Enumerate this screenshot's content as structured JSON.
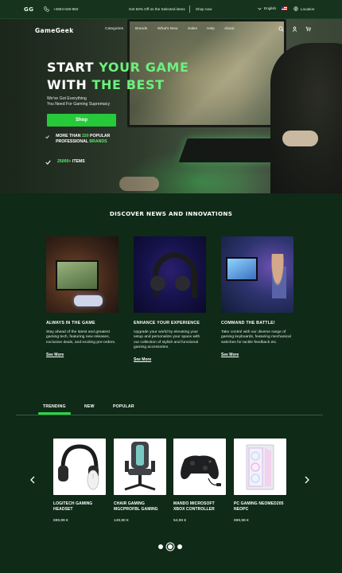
{
  "topbar": {
    "logo": "GG",
    "phone": "+4904-049-950",
    "promo": "Get 50% Off on the Selected items",
    "shop_now": "Shop now",
    "language": "English",
    "location": "Location"
  },
  "nav": {
    "brand": "GameGeek",
    "items": [
      "Categories",
      "Brands",
      "What's New",
      "Sales",
      "Help",
      "About"
    ]
  },
  "hero": {
    "title_line1_white": "START ",
    "title_line1_green": "YOUR GAME",
    "title_line2_white": "WITH ",
    "title_line2_green": "THE BEST",
    "subtitle_line1": "We've Got Everything",
    "subtitle_line2": "You Need For Gaming Supremacy",
    "cta": "Shop",
    "feature1_pre": "MORE THAN ",
    "feature1_num": "150",
    "feature1_mid": " POPULAR PROFESSIONAL ",
    "feature1_green": "BRANDS",
    "feature2_num": "25000+",
    "feature2_post": " ITEMS"
  },
  "discover": {
    "title": "DISCOVER NEWS AND INNOVATIONS",
    "cards": [
      {
        "title": "ALWAYS IN THE GAME",
        "text": "Stay ahead of the latest and greatest gaming tech, featuring new releases, exclusive deals, and exciting pre-orders.",
        "link": "See More"
      },
      {
        "title": "ENHANCE YOUR EXPERIENCE",
        "text": "Upgrade your world by elevating your setup and personalize your space with our collection of stylish and functional gaming accessories.",
        "link": "See More"
      },
      {
        "title": "COMMAND THE BATTLE!",
        "text": "Take control with our diverse range of gaming keyboards, featuring mechanical switches for tactile feedback etc.",
        "link": "See More"
      }
    ]
  },
  "tabs": [
    "TRENDING",
    "NEW",
    "POPULAR"
  ],
  "products": [
    {
      "name": "LOGITECH GAMING HEADSET",
      "price": "699,99 €"
    },
    {
      "name": "CHAIR GAMING MGCPROFBL GAMING",
      "price": "149,90 €"
    },
    {
      "name": "MANDO MICROSOFT XBOX CONTROLLER",
      "price": "54,99 €"
    },
    {
      "name": "PC GAMING NEOMED205 NEOPC",
      "price": "699,99 €"
    }
  ],
  "carousel": {
    "pages": 3,
    "active": 2
  },
  "colors": {
    "accent": "#26c93a",
    "background": "#0f2a17",
    "highlight": "#6cf07e"
  }
}
